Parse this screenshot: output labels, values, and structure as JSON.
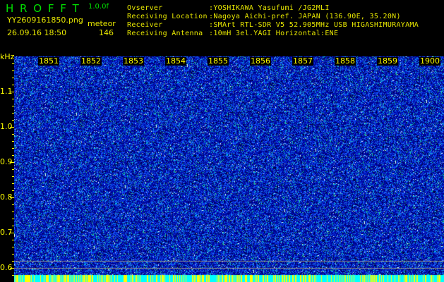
{
  "header": {
    "app_title": "H R O F F T",
    "version": "1.0.0f",
    "filename": "YY2609161850.png",
    "datetime": "26.09.16 18:50",
    "detector_label": "meteor",
    "count": "146"
  },
  "info": [
    {
      "label": "Ovserver",
      "value": ":YOSHIKAWA Yasufumi /JG2MLI"
    },
    {
      "label": "Receiving Location",
      "value": ":Nagoya Aichi-pref. JAPAN (136.90E, 35.20N)"
    },
    {
      "label": "Receiver",
      "value": ":SMArt RTL-SDR V5 52.905MHz USB HIGASHIMURAYAMA"
    },
    {
      "label": "Receiving Antenna",
      "value": ":10mH 3el.YAGI Horizontal:ENE"
    }
  ],
  "spectrogram": {
    "y_unit": "kHz",
    "y_ticks": [
      "1.1",
      "1.0",
      "0.9",
      "0.8",
      "0.7",
      "0.6"
    ],
    "time_labels": [
      "1851",
      "1852",
      "1853",
      "1854",
      "1855",
      "1856",
      "1857",
      "1858",
      "1859",
      "1900"
    ],
    "colors": {
      "background": "#000000",
      "noise_low": "#0000c0",
      "noise_mid": "#2060ff",
      "noise_high": "#00e0e0",
      "text_green": "#00e000",
      "text_yellow": "#e8e800"
    }
  }
}
